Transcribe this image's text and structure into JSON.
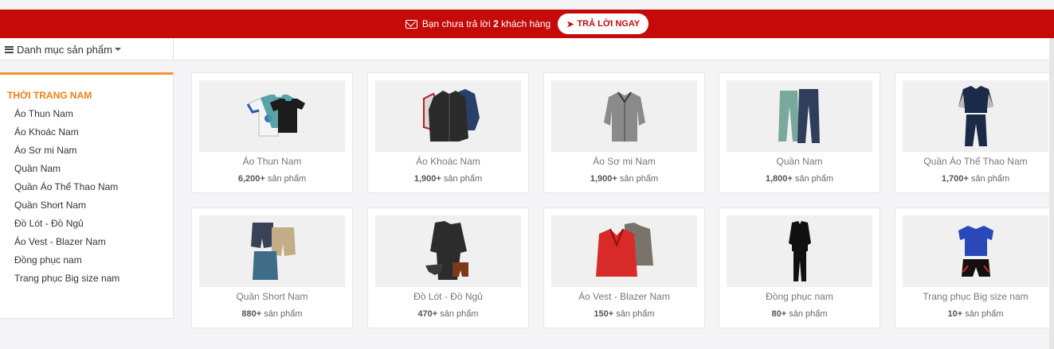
{
  "notification": {
    "text_before": "Bạn chưa trả lời ",
    "count": "2",
    "text_after": " khách hàng",
    "button_label": "TRẢ LỜI NGAY",
    "color": "#c50a0a"
  },
  "category_menu": {
    "label": "Danh mục sản phẩm"
  },
  "sidebar": {
    "heading": "THỜI TRANG NAM",
    "items": [
      {
        "label": "Áo Thun Nam"
      },
      {
        "label": "Áo Khoác Nam"
      },
      {
        "label": "Áo Sơ mi Nam"
      },
      {
        "label": "Quần Nam"
      },
      {
        "label": "Quần Áo Thể Thao Nam"
      },
      {
        "label": "Quần Short Nam"
      },
      {
        "label": "Đồ Lót - Đồ Ngủ"
      },
      {
        "label": "Áo Vest - Blazer Nam"
      },
      {
        "label": "Đồng phục nam"
      },
      {
        "label": "Trang phục Big size nam"
      }
    ],
    "accent": "#f07f13"
  },
  "products": [
    {
      "title": "Áo Thun Nam",
      "count": "6,200+",
      "unit": " sản phẩm",
      "icon": "tshirt-icon"
    },
    {
      "title": "Áo Khoác Nam",
      "count": "1,900+",
      "unit": " sản phẩm",
      "icon": "jacket-icon"
    },
    {
      "title": "Áo Sơ mi Nam",
      "count": "1,900+",
      "unit": " sản phẩm",
      "icon": "shirt-icon"
    },
    {
      "title": "Quần Nam",
      "count": "1,800+",
      "unit": " sản phẩm",
      "icon": "pants-icon"
    },
    {
      "title": "Quần Áo Thể Thao Nam",
      "count": "1,700+",
      "unit": " sản phẩm",
      "icon": "tracksuit-icon"
    },
    {
      "title": "Quần Short Nam",
      "count": "880+",
      "unit": " sản phẩm",
      "icon": "shorts-icon"
    },
    {
      "title": "Đồ Lót - Đồ Ngủ",
      "count": "470+",
      "unit": " sản phẩm",
      "icon": "underwear-icon"
    },
    {
      "title": "Áo Vest - Blazer Nam",
      "count": "150+",
      "unit": " sản phẩm",
      "icon": "blazer-icon"
    },
    {
      "title": "Đồng phục nam",
      "count": "80+",
      "unit": " sản phẩm",
      "icon": "uniform-icon"
    },
    {
      "title": "Trang phục Big size nam",
      "count": "10+",
      "unit": " sản phẩm",
      "icon": "sport-kit-icon"
    }
  ]
}
